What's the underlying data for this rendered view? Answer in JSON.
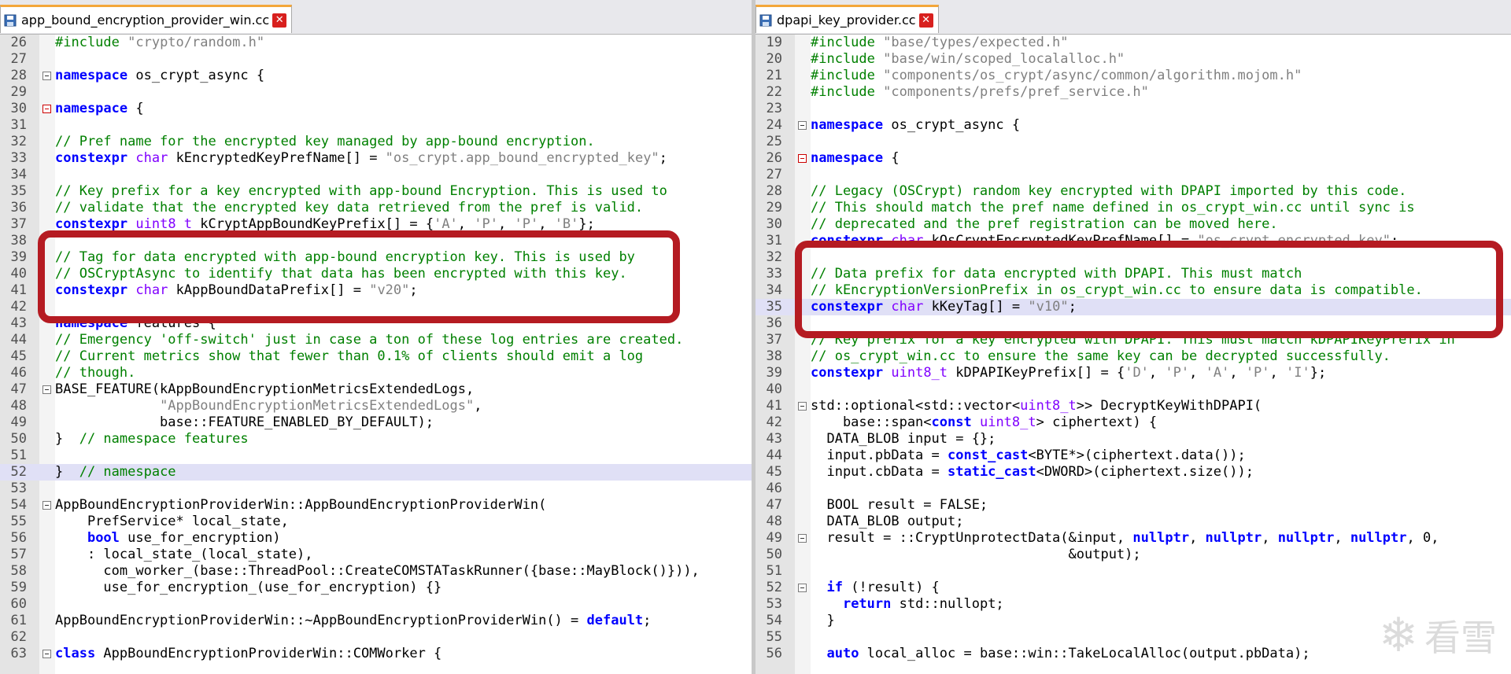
{
  "left": {
    "tab": "app_bound_encryption_provider_win.cc",
    "lines": [
      {
        "n": "26",
        "t": "#include \"crypto/random.h\""
      },
      {
        "n": "27",
        "t": ""
      },
      {
        "n": "28",
        "t": "namespace os_crypt_async {",
        "fold": true
      },
      {
        "n": "29",
        "t": ""
      },
      {
        "n": "30",
        "t": "namespace {",
        "fold": true,
        "redfold": true
      },
      {
        "n": "31",
        "t": ""
      },
      {
        "n": "32",
        "t": "// Pref name for the encrypted key managed by app-bound encryption."
      },
      {
        "n": "33",
        "t": "constexpr char kEncryptedKeyPrefName[] = \"os_crypt.app_bound_encrypted_key\";"
      },
      {
        "n": "34",
        "t": ""
      },
      {
        "n": "35",
        "t": "// Key prefix for a key encrypted with app-bound Encryption. This is used to"
      },
      {
        "n": "36",
        "t": "// validate that the encrypted key data retrieved from the pref is valid."
      },
      {
        "n": "37",
        "t": "constexpr uint8_t kCryptAppBoundKeyPrefix[] = {'A', 'P', 'P', 'B'};"
      },
      {
        "n": "38",
        "t": ""
      },
      {
        "n": "39",
        "t": "// Tag for data encrypted with app-bound encryption key. This is used by"
      },
      {
        "n": "40",
        "t": "// OSCryptAsync to identify that data has been encrypted with this key."
      },
      {
        "n": "41",
        "t": "constexpr char kAppBoundDataPrefix[] = \"v20\";"
      },
      {
        "n": "42",
        "t": ""
      },
      {
        "n": "43",
        "t": "namespace features {"
      },
      {
        "n": "44",
        "t": "// Emergency 'off-switch' just in case a ton of these log entries are created."
      },
      {
        "n": "45",
        "t": "// Current metrics show that fewer than 0.1% of clients should emit a log"
      },
      {
        "n": "46",
        "t": "// though."
      },
      {
        "n": "47",
        "t": "BASE_FEATURE(kAppBoundEncryptionMetricsExtendedLogs,",
        "fold": true
      },
      {
        "n": "48",
        "t": "             \"AppBoundEncryptionMetricsExtendedLogs\","
      },
      {
        "n": "49",
        "t": "             base::FEATURE_ENABLED_BY_DEFAULT);"
      },
      {
        "n": "50",
        "t": "}  // namespace features"
      },
      {
        "n": "51",
        "t": ""
      },
      {
        "n": "52",
        "t": "}  // namespace",
        "hl": true
      },
      {
        "n": "53",
        "t": ""
      },
      {
        "n": "54",
        "t": "AppBoundEncryptionProviderWin::AppBoundEncryptionProviderWin(",
        "fold": true
      },
      {
        "n": "55",
        "t": "    PrefService* local_state,"
      },
      {
        "n": "56",
        "t": "    bool use_for_encryption)"
      },
      {
        "n": "57",
        "t": "    : local_state_(local_state),"
      },
      {
        "n": "58",
        "t": "      com_worker_(base::ThreadPool::CreateCOMSTATaskRunner({base::MayBlock()})),"
      },
      {
        "n": "59",
        "t": "      use_for_encryption_(use_for_encryption) {}"
      },
      {
        "n": "60",
        "t": ""
      },
      {
        "n": "61",
        "t": "AppBoundEncryptionProviderWin::~AppBoundEncryptionProviderWin() = default;"
      },
      {
        "n": "62",
        "t": ""
      },
      {
        "n": "63",
        "t": "class AppBoundEncryptionProviderWin::COMWorker {",
        "fold": true
      }
    ]
  },
  "right": {
    "tab": "dpapi_key_provider.cc",
    "lines": [
      {
        "n": "19",
        "t": "#include \"base/types/expected.h\""
      },
      {
        "n": "20",
        "t": "#include \"base/win/scoped_localalloc.h\""
      },
      {
        "n": "21",
        "t": "#include \"components/os_crypt/async/common/algorithm.mojom.h\""
      },
      {
        "n": "22",
        "t": "#include \"components/prefs/pref_service.h\""
      },
      {
        "n": "23",
        "t": ""
      },
      {
        "n": "24",
        "t": "namespace os_crypt_async {",
        "fold": true
      },
      {
        "n": "25",
        "t": ""
      },
      {
        "n": "26",
        "t": "namespace {",
        "fold": true,
        "redfold": true
      },
      {
        "n": "27",
        "t": ""
      },
      {
        "n": "28",
        "t": "// Legacy (OSCrypt) random key encrypted with DPAPI imported by this code."
      },
      {
        "n": "29",
        "t": "// This should match the pref name defined in os_crypt_win.cc until sync is"
      },
      {
        "n": "30",
        "t": "// deprecated and the pref registration can be moved here."
      },
      {
        "n": "31",
        "t": "constexpr char kOsCryptEncryptedKeyPrefName[] = \"os_crypt.encrypted_key\";"
      },
      {
        "n": "32",
        "t": ""
      },
      {
        "n": "33",
        "t": "// Data prefix for data encrypted with DPAPI. This must match"
      },
      {
        "n": "34",
        "t": "// kEncryptionVersionPrefix in os_crypt_win.cc to ensure data is compatible."
      },
      {
        "n": "35",
        "t": "constexpr char kKeyTag[] = \"v10\";",
        "hl": true
      },
      {
        "n": "36",
        "t": ""
      },
      {
        "n": "37",
        "t": "// Key prefix for a key encrypted with DPAPI. This must match kDPAPIKeyPrefix in"
      },
      {
        "n": "38",
        "t": "// os_crypt_win.cc to ensure the same key can be decrypted successfully."
      },
      {
        "n": "39",
        "t": "constexpr uint8_t kDPAPIKeyPrefix[] = {'D', 'P', 'A', 'P', 'I'};"
      },
      {
        "n": "40",
        "t": ""
      },
      {
        "n": "41",
        "t": "std::optional<std::vector<uint8_t>> DecryptKeyWithDPAPI(",
        "fold": true
      },
      {
        "n": "42",
        "t": "    base::span<const uint8_t> ciphertext) {"
      },
      {
        "n": "43",
        "t": "  DATA_BLOB input = {};"
      },
      {
        "n": "44",
        "t": "  input.pbData = const_cast<BYTE*>(ciphertext.data());"
      },
      {
        "n": "45",
        "t": "  input.cbData = static_cast<DWORD>(ciphertext.size());"
      },
      {
        "n": "46",
        "t": ""
      },
      {
        "n": "47",
        "t": "  BOOL result = FALSE;"
      },
      {
        "n": "48",
        "t": "  DATA_BLOB output;"
      },
      {
        "n": "49",
        "t": "  result = ::CryptUnprotectData(&input, nullptr, nullptr, nullptr, nullptr, 0,",
        "fold": true
      },
      {
        "n": "50",
        "t": "                                &output);"
      },
      {
        "n": "51",
        "t": ""
      },
      {
        "n": "52",
        "t": "  if (!result) {",
        "fold": true
      },
      {
        "n": "53",
        "t": "    return std::nullopt;"
      },
      {
        "n": "54",
        "t": "  }"
      },
      {
        "n": "55",
        "t": ""
      },
      {
        "n": "56",
        "t": "  auto local_alloc = base::win::TakeLocalAlloc(output.pbData);"
      }
    ]
  },
  "watermark": {
    "text": "看雪"
  },
  "theme": {
    "keyword": "#0000ff",
    "type": "#8000ff",
    "string": "#808080",
    "comment": "#008000",
    "annotation": "#b51b22",
    "line_highlight": "#e0e0f6",
    "tab_accent": "#f3a63a"
  }
}
